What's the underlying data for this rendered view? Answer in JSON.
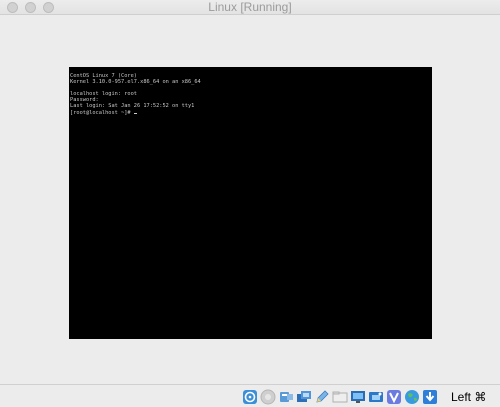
{
  "window": {
    "title": "Linux [Running]"
  },
  "console": {
    "lines": [
      "CentOS Linux 7 (Core)",
      "Kernel 3.10.0-957.el7.x86_64 on an x86_64",
      "",
      "localhost login: root",
      "Password:",
      "Last login: Sat Jan 26 17:52:52 on tty1",
      "[root@localhost ~]# "
    ]
  },
  "statusbar": {
    "icons": [
      "optical-drive-icon",
      "audio-icon",
      "usb-icon",
      "network-icon",
      "pencil-icon",
      "shared-folder-icon",
      "display-icon",
      "capture-icon",
      "virtualbox-icon",
      "globe-icon",
      "download-arrow-icon"
    ],
    "host_key": "Left ⌘"
  },
  "colors": {
    "console_bg": "#000000",
    "console_text": "#c9c9c9",
    "chrome_bg": "#ececec",
    "title_text": "#9b9b9b"
  }
}
